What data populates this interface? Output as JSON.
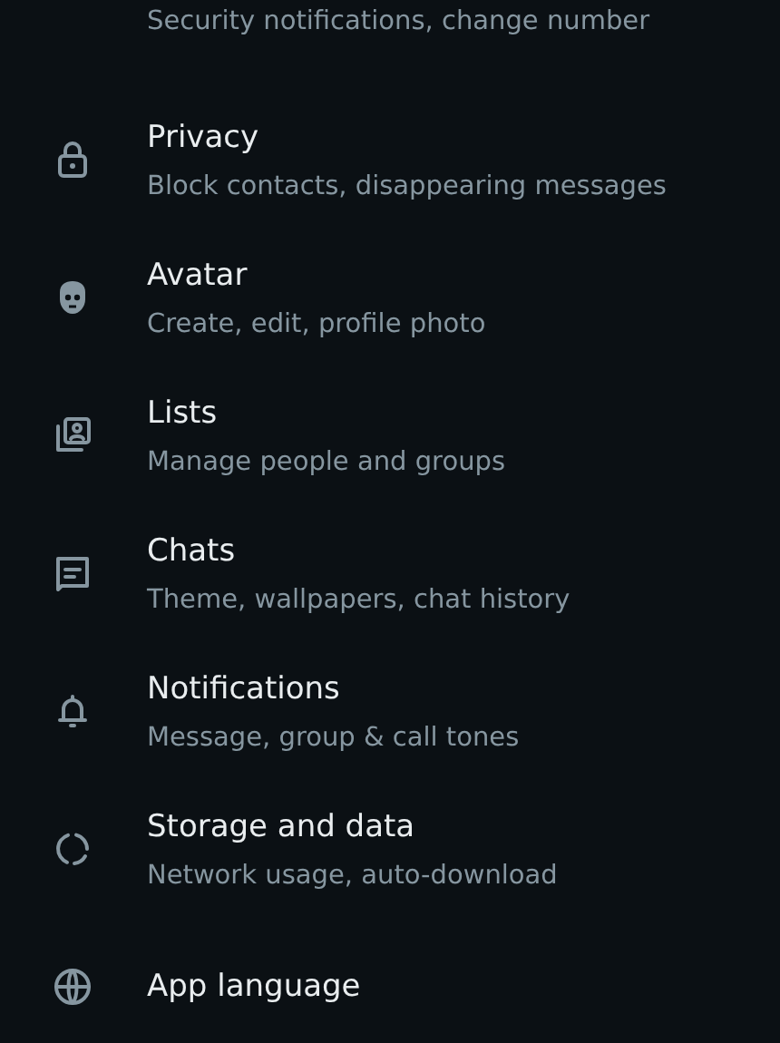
{
  "settings_items": [
    {
      "subtitle": "Security notifications, change number"
    },
    {
      "kind": "lock",
      "title": "Privacy",
      "subtitle": "Block contacts, disappearing messages"
    },
    {
      "kind": "avatar",
      "title": "Avatar",
      "subtitle": "Create, edit, profile photo"
    },
    {
      "kind": "lists",
      "title": "Lists",
      "subtitle": "Manage people and groups"
    },
    {
      "kind": "chats",
      "title": "Chats",
      "subtitle": "Theme, wallpapers, chat history"
    },
    {
      "kind": "bell",
      "title": "Notifications",
      "subtitle": "Message, group & call tones"
    },
    {
      "kind": "storage",
      "title": "Storage and data",
      "subtitle": "Network usage, auto-download"
    },
    {
      "kind": "globe",
      "title": "App language"
    }
  ]
}
